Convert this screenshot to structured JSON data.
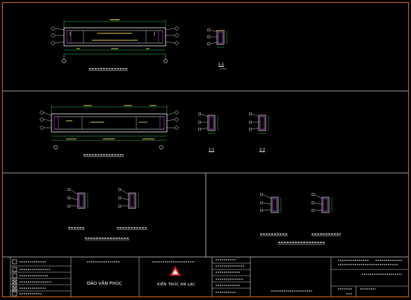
{
  "drawing": {
    "background": "#000000",
    "frame_color": "#c8641e",
    "line_color": "#ffffff",
    "dimension_color": "#39d353",
    "rebar_color": "#c058d8",
    "section_labels": [
      "1-1",
      "1-1",
      "2-2"
    ],
    "title_block": {
      "signer_name": "ĐÀO VĂN PHÚC",
      "company_name": "KIẾN TRÚC AN LẠC",
      "logo_icon": "red-triangle-logo-icon",
      "logo_color": "#d9211f",
      "checkbox_icon": "checkbox-icon"
    }
  }
}
